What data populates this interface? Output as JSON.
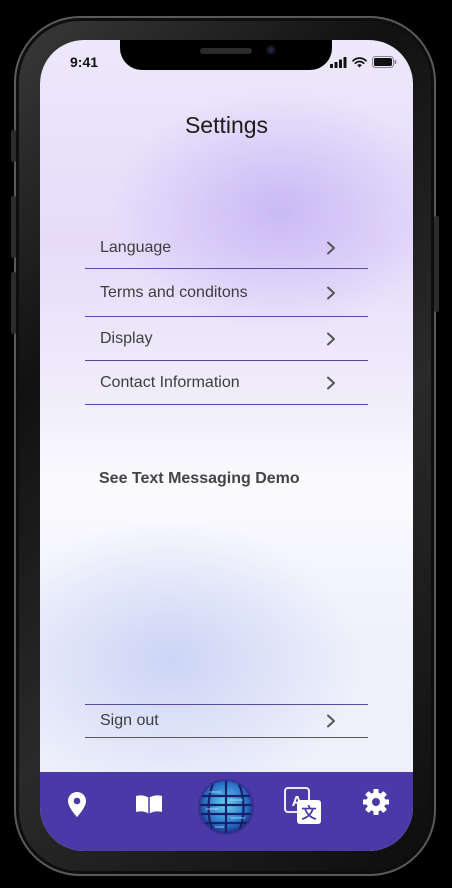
{
  "status_bar": {
    "time": "9:41"
  },
  "header": {
    "title": "Settings"
  },
  "menu": [
    {
      "label": "Language"
    },
    {
      "label": "Terms and conditons"
    },
    {
      "label": "Display"
    },
    {
      "label": "Contact Information"
    }
  ],
  "demo_link": "See Text Messaging Demo",
  "sign_out": "Sign out",
  "nav": [
    {
      "icon": "map-pin-icon"
    },
    {
      "icon": "book-icon"
    },
    {
      "icon": "globe-logo-icon"
    },
    {
      "icon": "translate-icon"
    },
    {
      "icon": "gear-icon"
    }
  ],
  "colors": {
    "accent": "#4a39a6",
    "divider": "#5a4aa8",
    "text": "#3d3d3d"
  }
}
